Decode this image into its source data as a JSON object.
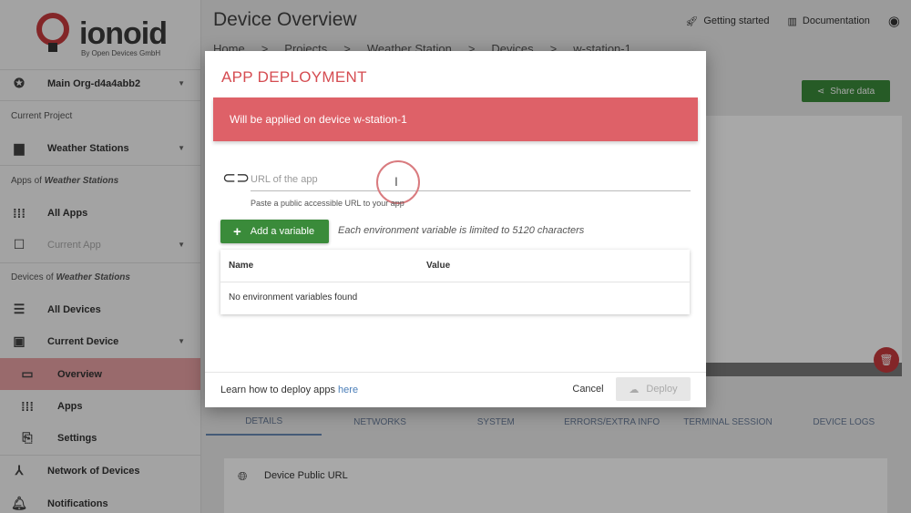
{
  "app": {
    "logo_text": "ionoid",
    "logo_sub": "By Open Devices GmbH"
  },
  "sidebar": {
    "org": "Main Org-d4a4abb2",
    "current_project_label": "Current Project",
    "project": "Weather Stations",
    "apps_of_prefix": "Apps of",
    "apps_of_project": "Weather Stations",
    "all_apps": "All Apps",
    "current_app": "Current App",
    "devices_of_prefix": "Devices of",
    "devices_of_project": "Weather Stations",
    "all_devices": "All Devices",
    "current_device": "Current Device",
    "overview": "Overview",
    "apps": "Apps",
    "settings": "Settings",
    "network": "Network of Devices",
    "notifications": "Notifications"
  },
  "header": {
    "title": "Device Overview",
    "getting_started": "Getting started",
    "documentation": "Documentation",
    "breadcrumb": [
      "Home",
      ">",
      "Projects",
      ">",
      "Weather Station",
      ">",
      "Devices",
      ">",
      "w-station-1"
    ]
  },
  "page": {
    "share_data": "Share data",
    "tabs": [
      "DETAILS",
      "NETWORKS",
      "SYSTEM",
      "ERRORS/EXTRA INFO",
      "TERMINAL SESSION",
      "DEVICE LOGS"
    ],
    "public_url_label": "Device Public URL"
  },
  "modal": {
    "title": "APP DEPLOYMENT",
    "alert": "Will be applied on device w-station-1",
    "url_placeholder": "URL of the app",
    "url_value": "",
    "url_hint": "Paste a public accessible URL to your app",
    "add_variable": "Add a variable",
    "variable_note": "Each environment variable is limited to 5120 characters",
    "col_name": "Name",
    "col_value": "Value",
    "empty": "No environment variables found",
    "learn_text": "Learn how to deploy apps",
    "learn_link": "here",
    "cancel": "Cancel",
    "deploy": "Deploy"
  },
  "colors": {
    "brand_red": "#c73a3e",
    "alert_red": "#de6168",
    "green": "#3a8b3a"
  }
}
